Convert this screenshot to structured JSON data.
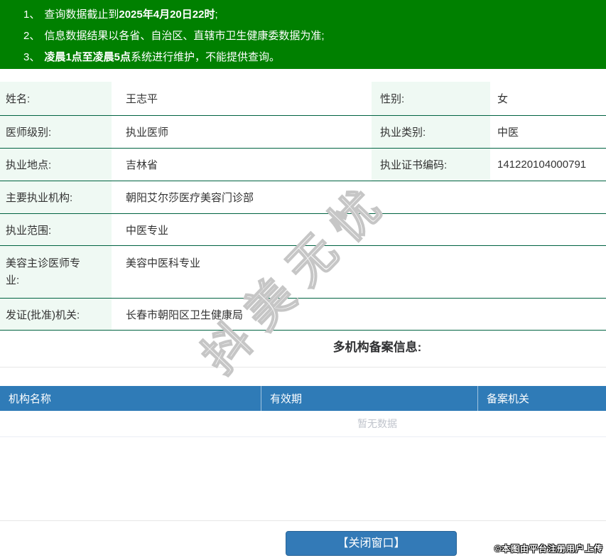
{
  "banner": {
    "notices": [
      {
        "num": "1、",
        "pre": "查询数据截止到",
        "bold": "2025年4月20日22时",
        "post": ";"
      },
      {
        "num": "2、",
        "pre": "信息数据结果以各省、自治区、直辖市卫生健康委数据为准;",
        "bold": "",
        "post": ""
      },
      {
        "num": "3、",
        "pre": "",
        "bold": "凌晨1点至凌晨5点",
        "post": "系统进行维护，不能提供查询。"
      }
    ]
  },
  "info": {
    "rows": [
      {
        "label": "姓名:",
        "value": "王志平",
        "label2": "性别:",
        "value2": "女"
      },
      {
        "label": "医师级别:",
        "value": "执业医师",
        "label2": "执业类别:",
        "value2": "中医"
      },
      {
        "label": "执业地点:",
        "value": "吉林省",
        "label2": "执业证书编码:",
        "value2": "141220104000791"
      },
      {
        "label": "主要执业机构:",
        "value": "朝阳艾尔莎医疗美容门诊部"
      },
      {
        "label": "执业范围:",
        "value": "中医专业"
      },
      {
        "label": "美容主诊医师专业:",
        "value": "美容中医科专业"
      },
      {
        "label": "发证(批准)机关:",
        "value": "长春市朝阳区卫生健康局"
      }
    ]
  },
  "registry": {
    "section_title": "多机构备案信息:",
    "columns": [
      "机构名称",
      "有效期",
      "备案机关"
    ],
    "empty_text": "暂无数据",
    "rows": []
  },
  "watermark": {
    "text": "抖美无忧"
  },
  "footer": {
    "close_button_label": "【关闭窗口】",
    "credit": "©本图由平台注册用户上传"
  },
  "colors": {
    "banner_green": "#008000",
    "divider_green": "#006341",
    "label_bg": "#eff9f3",
    "table_header_blue": "#2f7bb7",
    "button_blue": "#337ab7",
    "muted_text": "#c0c4cc"
  }
}
